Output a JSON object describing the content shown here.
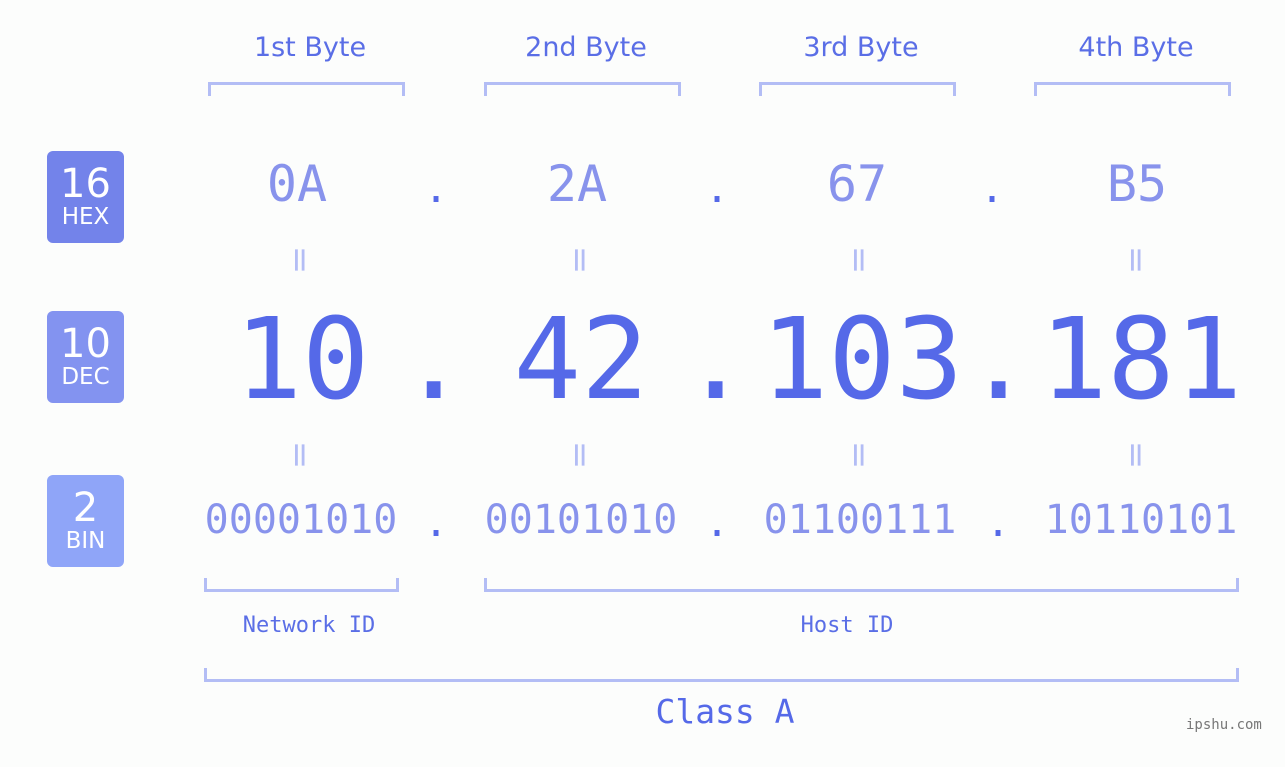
{
  "bytes": [
    {
      "label": "1st Byte",
      "hex": "0A",
      "dec": "10",
      "bin": "00001010"
    },
    {
      "label": "2nd Byte",
      "hex": "2A",
      "dec": "42",
      "bin": "00101010"
    },
    {
      "label": "3rd Byte",
      "hex": "67",
      "dec": "103",
      "bin": "01100111"
    },
    {
      "label": "4th Byte",
      "hex": "B5",
      "dec": "181",
      "bin": "10110101"
    }
  ],
  "badges": {
    "hex": {
      "num": "16",
      "label": "HEX",
      "color": "#7383ea"
    },
    "dec": {
      "num": "10",
      "label": "DEC",
      "color": "#8393f0"
    },
    "bin": {
      "num": "2",
      "label": "BIN",
      "color": "#8fa5f8"
    }
  },
  "separator": ".",
  "equals": "=",
  "network_label": "Network ID",
  "host_label": "Host ID",
  "class_label": "Class A",
  "watermark": "ipshu.com"
}
